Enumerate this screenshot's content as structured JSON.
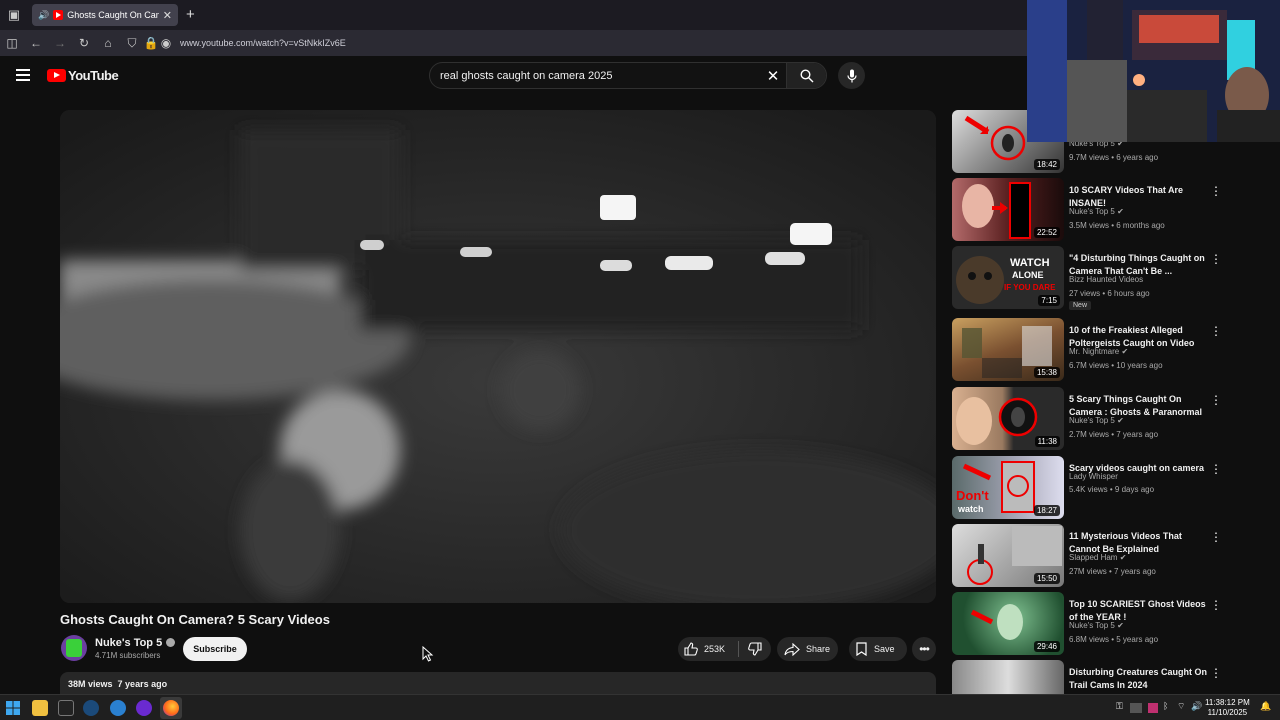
{
  "browser": {
    "tab_title": "Ghosts Caught On Camera? 5 Scary Videos - YouTube",
    "url": "www.youtube.com/watch?v=vStNkkIZv6E"
  },
  "youtube": {
    "logo_text": "YouTube",
    "search_query": "real ghosts caught on camera 2025"
  },
  "video": {
    "title": "Ghosts Caught On Camera? 5 Scary Videos",
    "channel": "Nuke's Top 5",
    "subscribers": "4.71M subscribers",
    "subscribe_label": "Subscribe",
    "likes": "253K",
    "share_label": "Share",
    "save_label": "Save",
    "views": "38M views",
    "age": "7 years ago"
  },
  "sidebar": {
    "items": [
      {
        "title": "",
        "channel": "Nuke's Top 5",
        "meta": "9.7M views • 6 years ago",
        "duration": "18:42",
        "verified": true
      },
      {
        "title": "10 SCARY Videos That Are INSANE!",
        "channel": "Nuke's Top 5",
        "meta": "3.5M views • 6 months ago",
        "duration": "22:52",
        "verified": true
      },
      {
        "title": "\"4 Disturbing Things Caught on Camera That Can't Be ...",
        "channel": "Bizz Haunted Videos",
        "meta": "27 views • 6 hours ago",
        "duration": "7:15",
        "badge": "New"
      },
      {
        "title": "10 of the Freakiest Alleged Poltergeists Caught on Video",
        "channel": "Mr. Nightmare",
        "meta": "6.7M views • 10 years ago",
        "duration": "15:38",
        "verified": true
      },
      {
        "title": "5 Scary Things Caught On Camera : Ghosts & Paranormal",
        "channel": "Nuke's Top 5",
        "meta": "2.7M views • 7 years ago",
        "duration": "11:38",
        "verified": true
      },
      {
        "title": "Scary videos caught on camera",
        "channel": "Lady Whisper",
        "meta": "5.4K views • 9 days ago",
        "duration": "18:27"
      },
      {
        "title": "11 Mysterious Videos That Cannot Be Explained",
        "channel": "Slapped Ham",
        "meta": "27M views • 7 years ago",
        "duration": "15:50",
        "verified": true
      },
      {
        "title": "Top 10 SCARIEST Ghost Videos of the YEAR !",
        "channel": "Nuke's Top 5",
        "meta": "6.8M views • 5 years ago",
        "duration": "29:46",
        "verified": true
      },
      {
        "title": "Disturbing Creatures Caught On Trail Cams In 2024",
        "channel": "",
        "meta": "",
        "duration": ""
      }
    ],
    "thumb_texts": {
      "watch_alone": "WATCH\nALONE",
      "if_you_dare": "IF YOU DARE",
      "dont_watch": "Don't watch"
    }
  },
  "taskbar": {
    "time": "11:38:12 PM",
    "date": "11/10/2025"
  },
  "colors": {
    "bg": "#0f0f0f",
    "accent_red": "#ff0000",
    "pill": "#272727"
  }
}
